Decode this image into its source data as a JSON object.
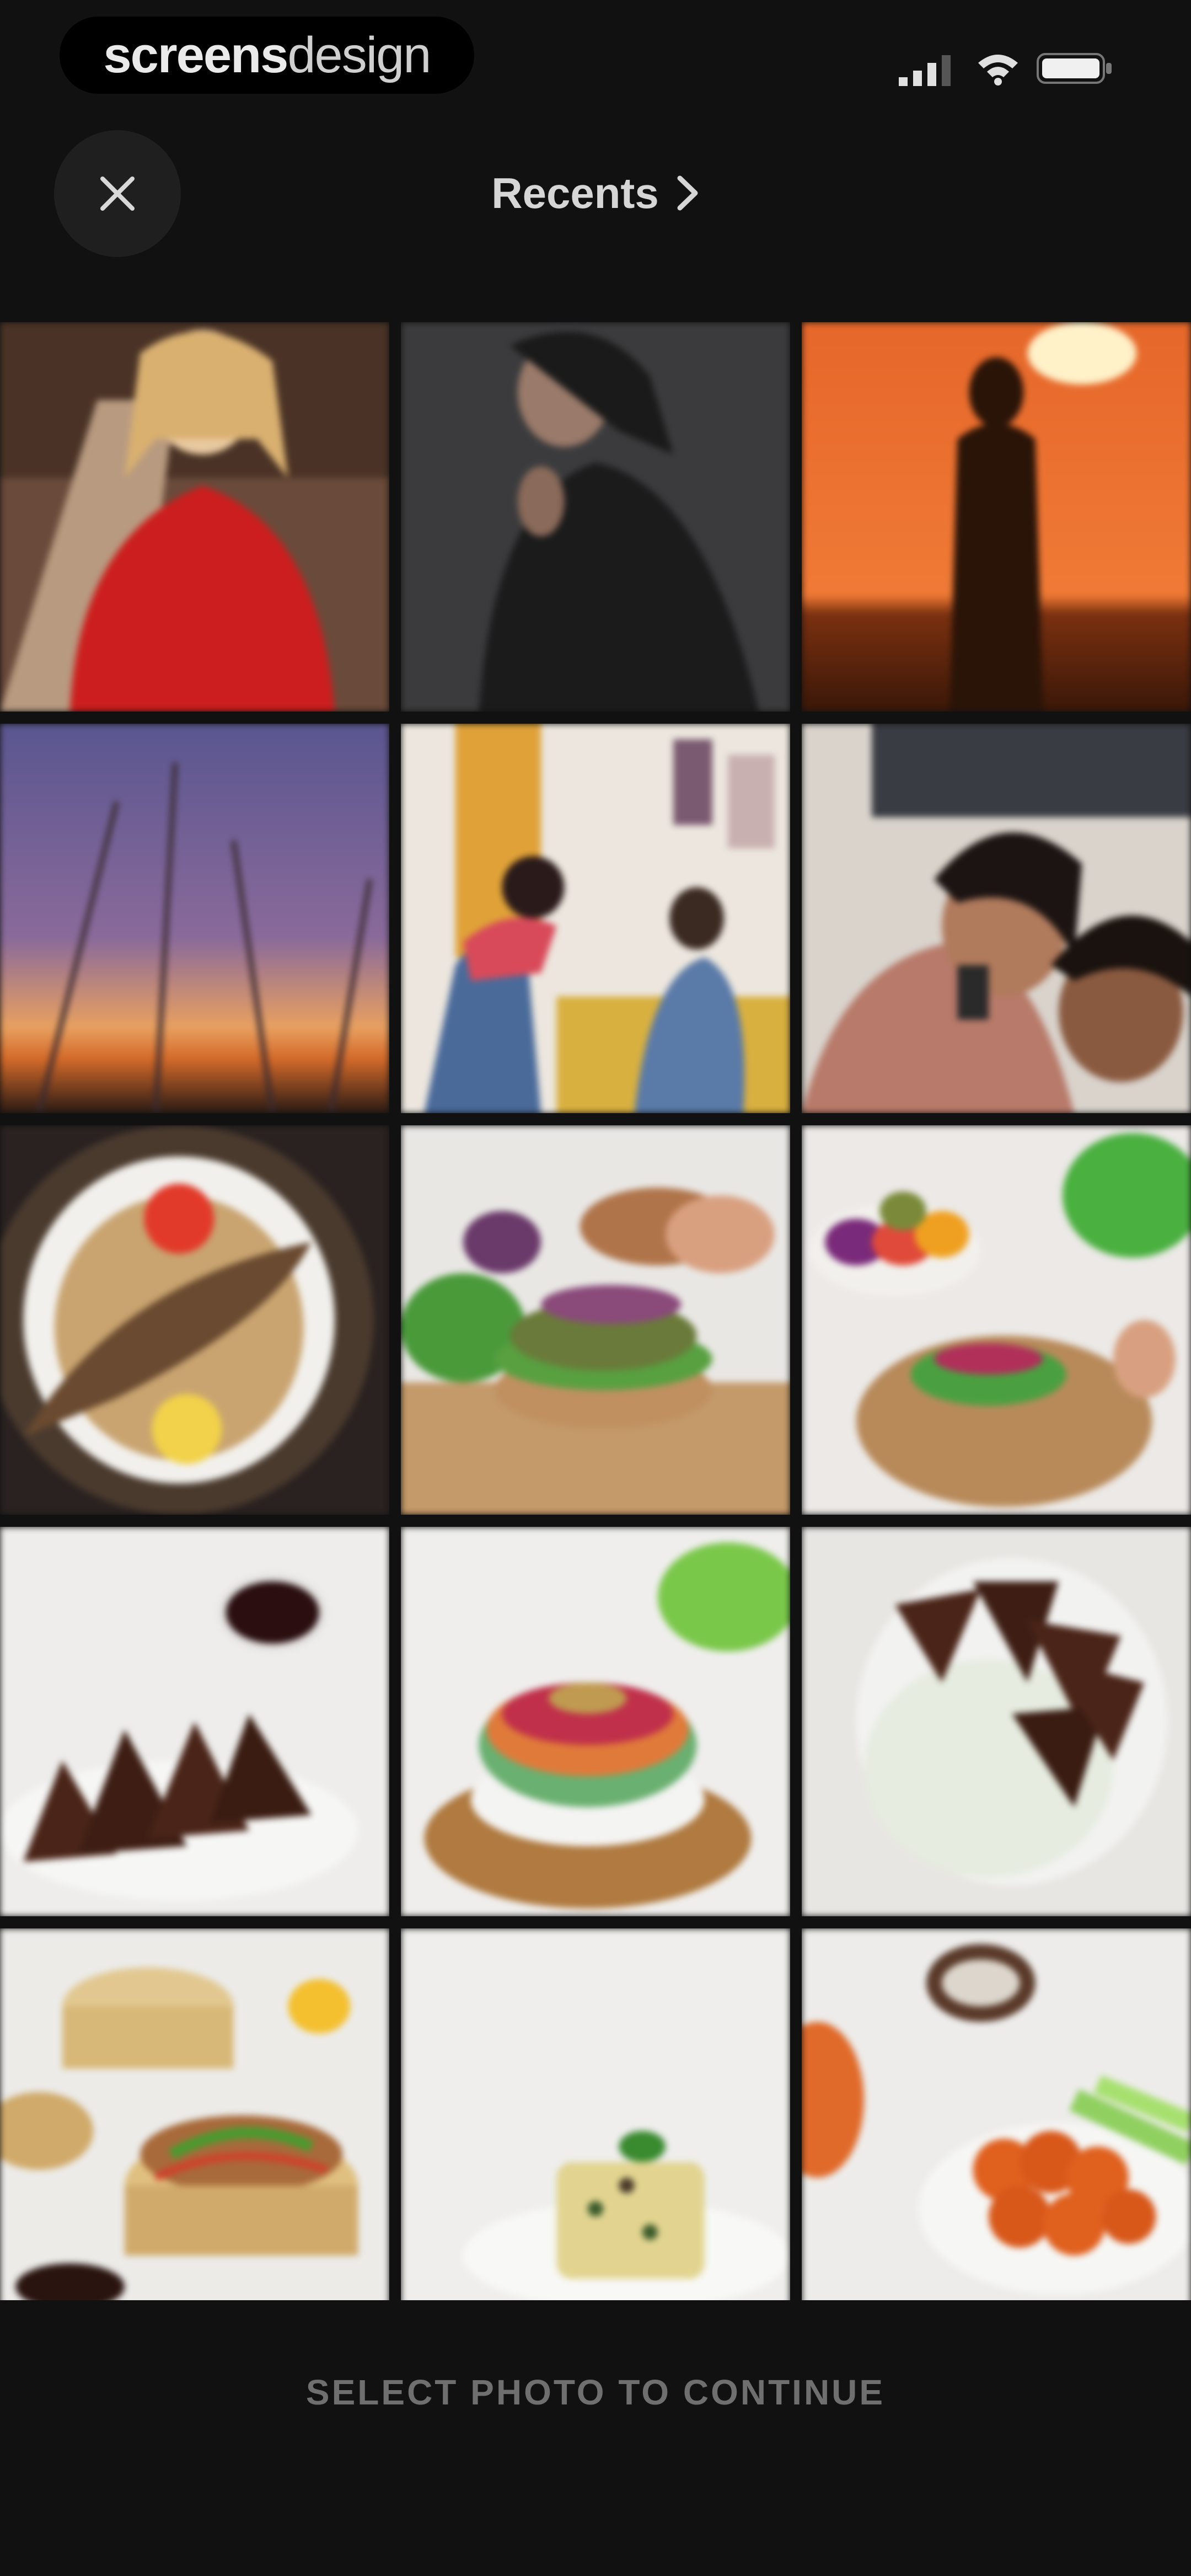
{
  "status_bar": {
    "brand_part1": "screens",
    "brand_part2": "design",
    "icons": [
      "signal-icon",
      "wifi-icon",
      "battery-icon"
    ]
  },
  "header": {
    "close_icon": "close-icon",
    "album_title": "Recents",
    "chevron_icon": "chevron-right-icon"
  },
  "photos": [
    {
      "subject": "woman in red sweater on path"
    },
    {
      "subject": "woman in black turtleneck with glasses"
    },
    {
      "subject": "silhouette at orange sunset"
    },
    {
      "subject": "purple sky over grass at dusk"
    },
    {
      "subject": "friends taking photos in living room"
    },
    {
      "subject": "two women smiling at phone"
    },
    {
      "subject": "fried fish on rice plate"
    },
    {
      "subject": "veggie burger assembly"
    },
    {
      "subject": "open burger with fresh vegetables"
    },
    {
      "subject": "seared tofu slices with soy sauce"
    },
    {
      "subject": "rainbow spring rolls on board"
    },
    {
      "subject": "tofu over rice in bowl"
    },
    {
      "subject": "bamboo steamer dumplings"
    },
    {
      "subject": "savory cake on white plate"
    },
    {
      "subject": "cauliflower bites with celery"
    }
  ],
  "footer": {
    "continue_label": "SELECT PHOTO TO CONTINUE"
  },
  "colors": {
    "background": "#111111",
    "text": "#d6d6d6",
    "muted": "#6f6f6f"
  }
}
